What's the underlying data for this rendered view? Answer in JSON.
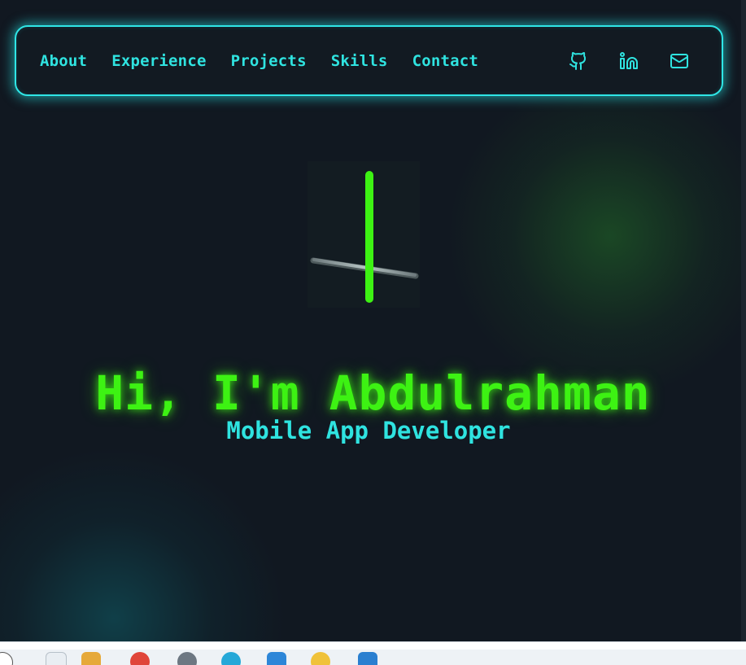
{
  "nav": {
    "links": [
      "About",
      "Experience",
      "Projects",
      "Skills",
      "Contact"
    ],
    "icons": [
      "github-icon",
      "linkedin-icon",
      "mail-icon"
    ]
  },
  "hero": {
    "title": "Hi, I'm Abdulrahman",
    "subtitle": "Mobile App Developer"
  },
  "colors": {
    "background": "#111821",
    "accent_cyan": "#2fe3e0",
    "accent_green": "#3df213"
  },
  "taskbar": {
    "icons": [
      "close-icon",
      "file-explorer-icon",
      "folder-icon",
      "chrome-icon",
      "settings-icon",
      "edge-icon",
      "store-icon",
      "app-icon",
      "vscode-icon"
    ]
  }
}
